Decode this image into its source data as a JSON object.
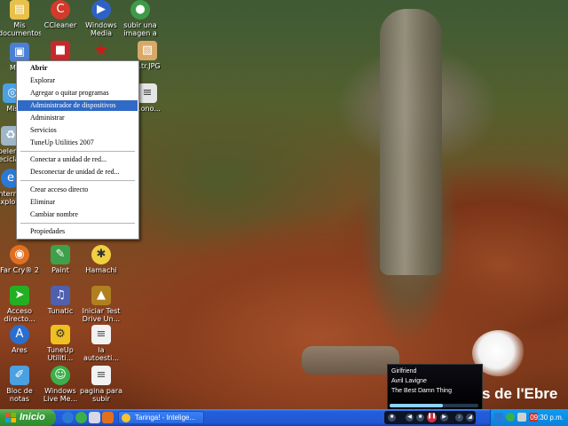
{
  "desktop": {
    "branding_text": "s de l'Ebre",
    "icons": [
      {
        "label": "Mis documentos",
        "icon": "folder-icon",
        "color": "#e8c04a"
      },
      {
        "label": "CCleaner",
        "icon": "ccleaner-icon",
        "color": "#d43a2a"
      },
      {
        "label": "Windows Media",
        "icon": "media-player-icon",
        "color": "#2f62c8"
      },
      {
        "label": "subir una imagen a",
        "icon": "chrome-icon",
        "color": "#3d9b48"
      },
      {
        "label": "Mi PC",
        "icon": "computer-icon",
        "color": "#4a7fd4"
      },
      {
        "label": "",
        "icon": "app-icon",
        "color": "#c8282c"
      },
      {
        "label": "",
        "icon": "star-icon",
        "color": "#d01818"
      },
      {
        "label": "...tr.JPG",
        "icon": "image-file-icon",
        "color": "#d8a868"
      },
      {
        "label": "Mis",
        "icon": "network-icon",
        "color": "#4aa0e0"
      },
      {
        "label": "...ono...",
        "icon": "document-icon",
        "color": "#e6e6e6"
      },
      {
        "label": "Papelera de reciclaje",
        "icon": "recycle-bin-icon",
        "color": "#9fb6c8"
      },
      {
        "label": "Internet Explorer",
        "icon": "ie-icon",
        "color": "#2a79d6"
      },
      {
        "label": "Far Cry® 2",
        "icon": "farcry-icon",
        "color": "#e07020"
      },
      {
        "label": "Paint",
        "icon": "paint-icon",
        "color": "#3ea04a"
      },
      {
        "label": "Hamachi",
        "icon": "hamachi-icon",
        "color": "#f0d040"
      },
      {
        "label": "Acceso directo...",
        "icon": "shortcut-arrow-icon",
        "color": "#22b022"
      },
      {
        "label": "Tunatic",
        "icon": "tunatic-icon",
        "color": "#5060b0"
      },
      {
        "label": "Iniciar Test Drive Un...",
        "icon": "testdrive-icon",
        "color": "#b08020"
      },
      {
        "label": "Ares",
        "icon": "ares-icon",
        "color": "#2a6fd0"
      },
      {
        "label": "TuneUp Utiliti...",
        "icon": "tuneup-icon",
        "color": "#f0c020"
      },
      {
        "label": "la autoesti...",
        "icon": "text-file-icon",
        "color": "#f2f2f2"
      },
      {
        "label": "Bloc de notas",
        "icon": "notepad-icon",
        "color": "#4aa0e0"
      },
      {
        "label": "Windows Live Me...",
        "icon": "messenger-icon",
        "color": "#3bb04a"
      },
      {
        "label": "pagina para subir imag...",
        "icon": "text-file-icon",
        "color": "#f2f2f2"
      }
    ]
  },
  "context_menu": {
    "items": [
      {
        "label": "Abrir",
        "bold": true
      },
      {
        "label": "Explorar"
      },
      {
        "label": "Agregar o quitar programas"
      },
      {
        "label": "Administrador de dispositivos",
        "highlighted": true
      },
      {
        "label": "Administrar"
      },
      {
        "label": "Servicios"
      },
      {
        "label": "TuneUp Utilities 2007"
      },
      {
        "label": "Conectar a unidad de red..."
      },
      {
        "label": "Desconectar de unidad de red..."
      },
      {
        "label": "Crear acceso directo"
      },
      {
        "label": "Eliminar"
      },
      {
        "label": "Cambiar nombre"
      },
      {
        "label": "Propiedades"
      }
    ]
  },
  "media_popup": {
    "song": "Girlfriend",
    "artist": "Avril Lavigne",
    "album": "The Best Damn Thing",
    "progress": 0.6
  },
  "taskbar": {
    "start_label": "Inicio",
    "quick_launch": [
      "ie-icon",
      "messenger-icon",
      "show-desktop-icon",
      "media-player-icon"
    ],
    "windows": [
      {
        "label": "Taringa! - Intelige...",
        "icon": "browser-icon"
      }
    ],
    "media_controls": [
      "stop-icon",
      "prev-icon",
      "play-pause-icon",
      "next-icon",
      "mute-icon",
      "volume-icon"
    ],
    "tray_icons": [
      "network-icon",
      "messenger-icon",
      "volume-icon",
      "security-icon"
    ],
    "clock": "09:30 p.m.",
    "colors": {
      "bar": "#245edb",
      "start": "#3b9a38",
      "tray": "#0f9cf0",
      "highlight": "#316ac5"
    }
  }
}
